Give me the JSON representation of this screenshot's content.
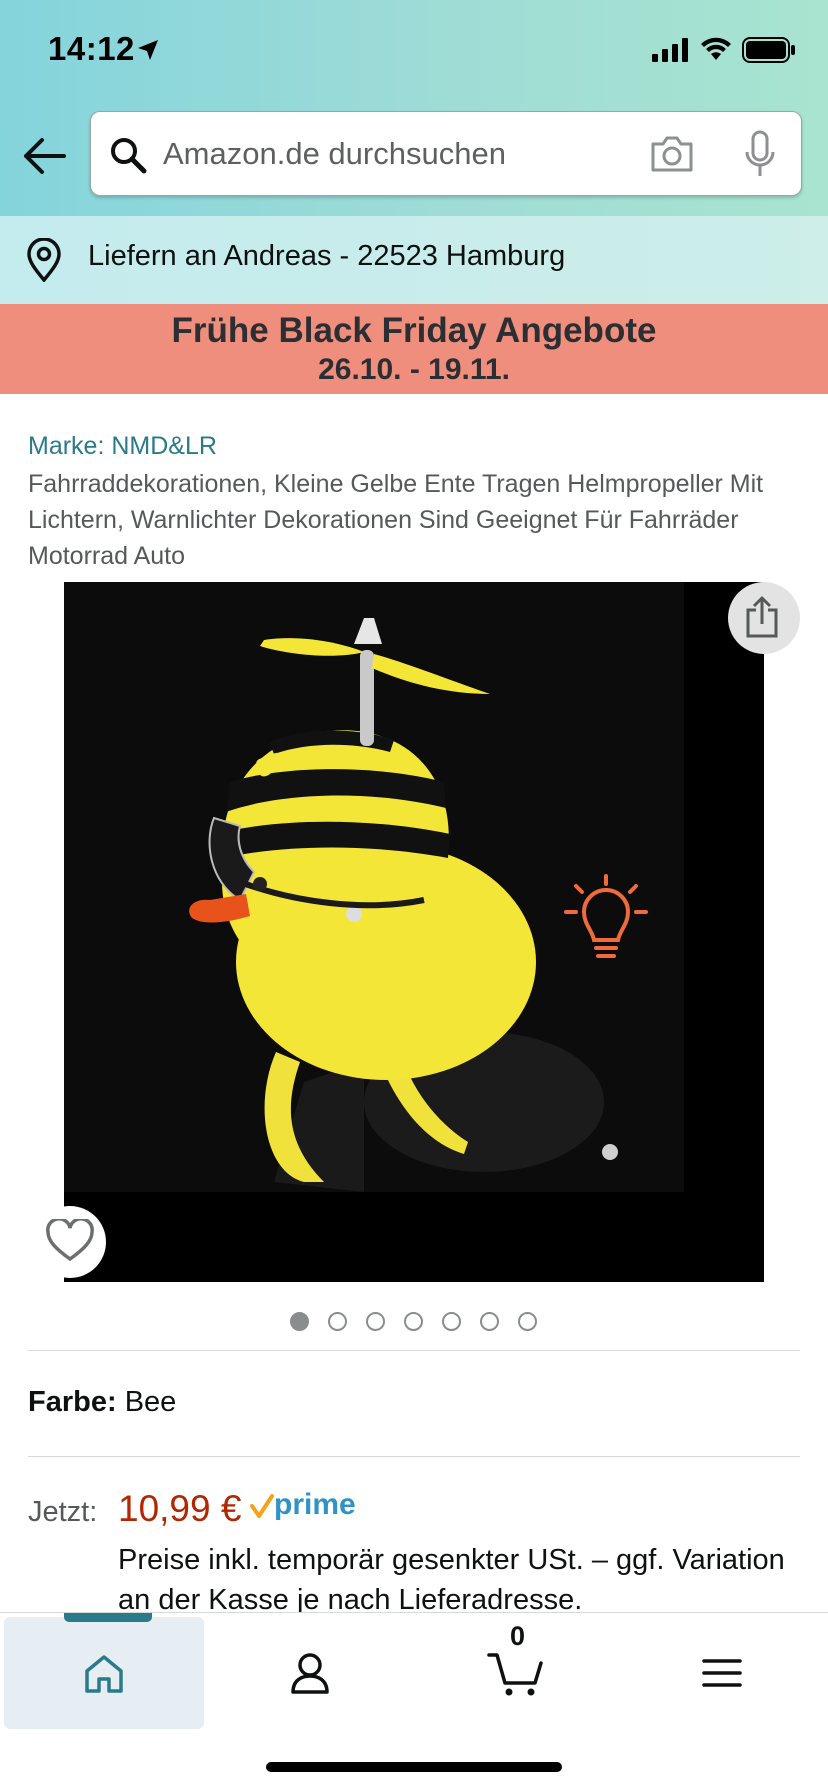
{
  "status_bar": {
    "time": "14:12"
  },
  "search": {
    "placeholder": "Amazon.de durchsuchen"
  },
  "delivery": {
    "text": "Liefern an Andreas - 22523 Hamburg"
  },
  "promo": {
    "title": "Frühe Black Friday Angebote",
    "dates": "26.10. - 19.11.",
    "background": "#ef8e7c"
  },
  "product": {
    "brand": "Marke: NMD&LR",
    "title": "Fahrraddekorationen, Kleine Gelbe Ente Tragen Helmpropeller Mit Lichtern, Warnlichter Dekorationen Sind Geeignet Für Fahrräder Motorrad Auto",
    "image_count": 7,
    "active_image": 1,
    "color_label": "Farbe:",
    "color_value": "Bee",
    "price_label": "Jetzt:",
    "price": "10,99 €",
    "prime": "prime",
    "price_note": "Preise inkl. temporär gesenkter USt. – ggf. Variation an der Kasse je nach Lieferadresse."
  },
  "bottom_nav": {
    "items": [
      "home-icon",
      "account-icon",
      "cart-icon",
      "menu-icon"
    ],
    "active": "home-icon",
    "cart_count": "0"
  },
  "colors": {
    "brand_link": "#2a7a8a",
    "price": "#b12704",
    "prime": "#2f93c8",
    "active_nav": "#2a7a8a"
  }
}
